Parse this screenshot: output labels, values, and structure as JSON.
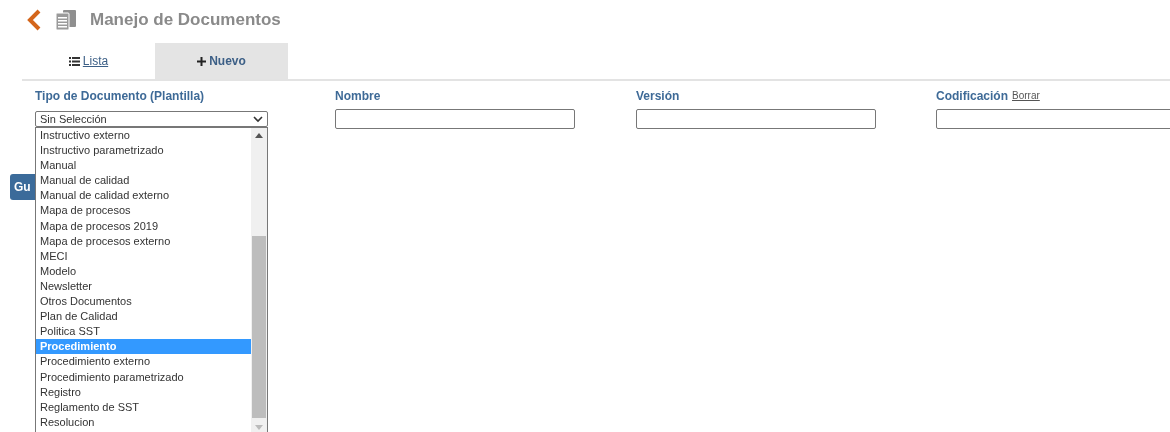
{
  "header": {
    "title": "Manejo de Documentos"
  },
  "tabs": [
    {
      "label": "Lista",
      "selected": false,
      "kind": "list"
    },
    {
      "label": "Nuevo",
      "selected": true,
      "kind": "new"
    }
  ],
  "form": {
    "fields": [
      {
        "kind": "select",
        "label": "Tipo de Documento (Plantilla)",
        "value": "Sin Selección"
      },
      {
        "kind": "text",
        "label": "Nombre"
      },
      {
        "kind": "text",
        "label": "Versión"
      },
      {
        "kind": "text",
        "label": "Codificación",
        "link": "Borrar"
      }
    ]
  },
  "save_button": {
    "label": "Gu"
  },
  "dropdown": {
    "options": [
      {
        "label": "Instructivo externo",
        "selected": false
      },
      {
        "label": "Instructivo parametrizado",
        "selected": false
      },
      {
        "label": "Manual",
        "selected": false
      },
      {
        "label": "Manual de calidad",
        "selected": false
      },
      {
        "label": "Manual de calidad externo",
        "selected": false
      },
      {
        "label": "Mapa de procesos",
        "selected": false
      },
      {
        "label": "Mapa de procesos 2019",
        "selected": false
      },
      {
        "label": "Mapa de procesos externo",
        "selected": false
      },
      {
        "label": "MECI",
        "selected": false
      },
      {
        "label": "Modelo",
        "selected": false
      },
      {
        "label": "Newsletter",
        "selected": false
      },
      {
        "label": "Otros Documentos",
        "selected": false
      },
      {
        "label": "Plan de Calidad",
        "selected": false
      },
      {
        "label": "Politica SST",
        "selected": false
      },
      {
        "label": "Procedimiento",
        "selected": true
      },
      {
        "label": "Procedimiento externo",
        "selected": false
      },
      {
        "label": "Procedimiento parametrizado",
        "selected": false
      },
      {
        "label": "Registro",
        "selected": false
      },
      {
        "label": "Reglamento de SST",
        "selected": false
      },
      {
        "label": "Resolucion",
        "selected": false
      }
    ]
  }
}
